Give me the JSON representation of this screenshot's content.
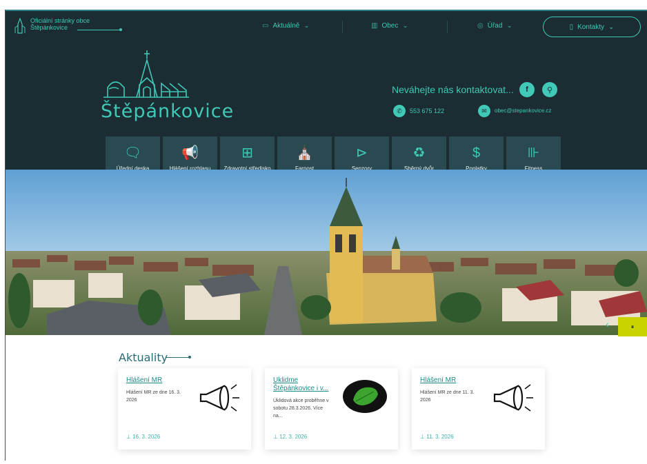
{
  "topbar": {
    "site_title": "Oficiální stránky obce Štěpánkovice",
    "nav": [
      "Aktuálně",
      "Obec",
      "Úřad"
    ],
    "contact_button": "Kontakty"
  },
  "brand": {
    "name": "Štěpánkovice"
  },
  "contact": {
    "heading": "Neváhejte nás kontaktovat...",
    "phone": "553 675 122",
    "email": "obec@stepankovice.cz"
  },
  "tiles": [
    {
      "label": "Úřední deska",
      "icon": "board-icon"
    },
    {
      "label": "Hlášení rozhlasu",
      "icon": "megaphone-icon"
    },
    {
      "label": "Zdravotní středisko",
      "icon": "medical-icon"
    },
    {
      "label": "Farnost",
      "icon": "church-icon"
    },
    {
      "label": "Senzory",
      "icon": "camera-icon"
    },
    {
      "label": "Sběrný dvůr",
      "icon": "recycle-icon"
    },
    {
      "label": "Poplatky",
      "icon": "money-bag-icon"
    },
    {
      "label": "Fitness",
      "icon": "dumbbell-icon"
    }
  ],
  "news": {
    "title": "Aktuality",
    "cards": [
      {
        "title": "Hlášení MR",
        "text": "Hlášení MR ze dne 16. 3. 2026",
        "date": "16. 3. 2026",
        "image": "megaphone-icon"
      },
      {
        "title": "Uklidme Štěpánkovice i v...",
        "text": "Úklidová akce proběhne v sobotu 28.3.2026. Více na...",
        "date": "12. 3. 2026",
        "image": "oak-leaf-logo"
      },
      {
        "title": "Hlášení MR",
        "text": "Hlášení MR ze dne 11. 3. 2026",
        "date": "11. 3. 2026",
        "image": "megaphone-icon"
      }
    ]
  },
  "colors": {
    "header_bg": "#1b2c32",
    "accent": "#3fc9b6",
    "tile_bg": "#2a4a52",
    "hero_button": "#c9d300"
  }
}
